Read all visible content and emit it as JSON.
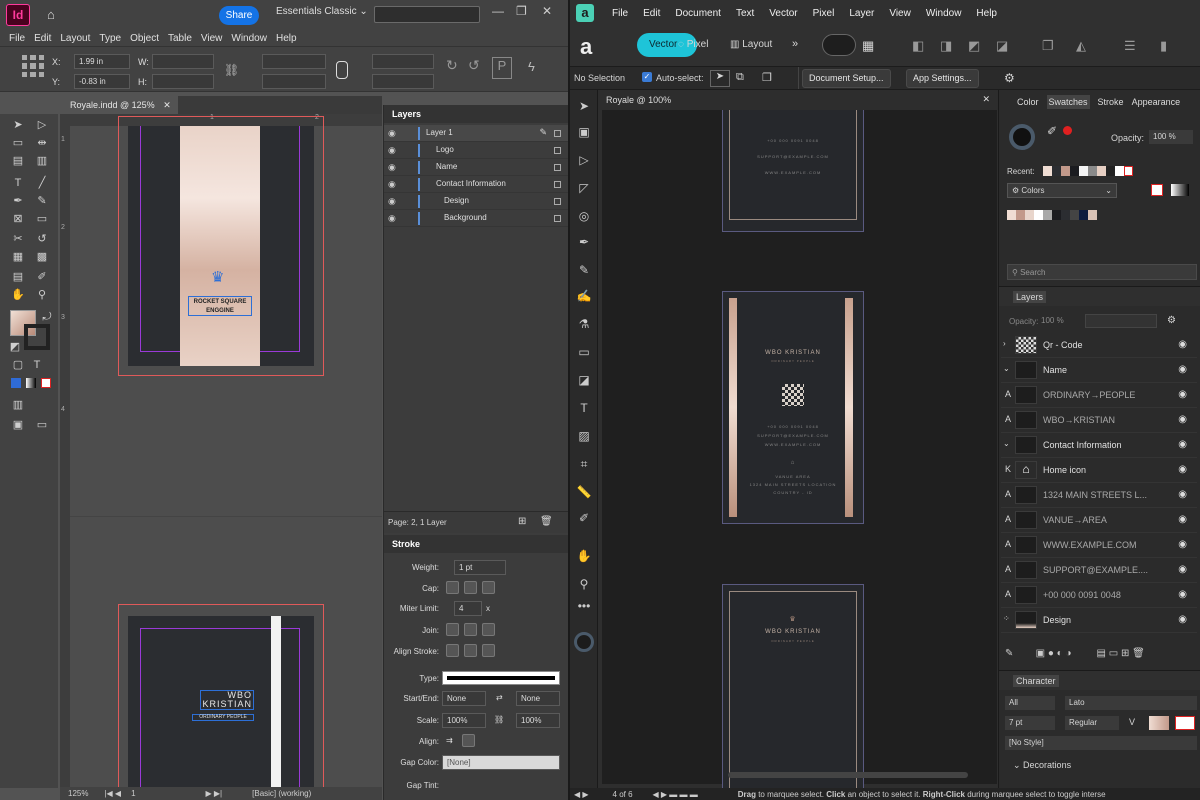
{
  "indesign": {
    "app_icon": "Id",
    "share_label": "Share",
    "workspace": "Essentials Classic",
    "menu": [
      "File",
      "Edit",
      "Layout",
      "Type",
      "Object",
      "Table",
      "View",
      "Window",
      "Help"
    ],
    "x_label": "X:",
    "x_value": "1.99 in",
    "y_label": "Y:",
    "y_value": "-0.83 in",
    "w_label": "W:",
    "h_label": "H:",
    "doc_tab": "Royale.indd @ 125%",
    "ruler_marks": [
      "1",
      "2",
      "3",
      "4"
    ],
    "top_ruler": [
      "1",
      "2"
    ],
    "page1_text_line1": "ROCKET SQUARE",
    "page1_text_line2": "ENGGINE",
    "page2_name_line1": "WBO",
    "page2_name_line2": "KRISTIAN",
    "page2_tagline": "ORDINARY PEOPLE",
    "zoom": "125%",
    "page_number": "1",
    "status": "[Basic] (working)",
    "layers": {
      "title": "Layers",
      "items": [
        "Layer 1",
        "Logo",
        "Name",
        "Contact Information",
        "Design",
        "Background"
      ],
      "footer": "Page: 2, 1 Layer"
    },
    "stroke": {
      "title": "Stroke",
      "weight_label": "Weight:",
      "weight": "1 pt",
      "cap_label": "Cap:",
      "miter_label": "Miter Limit:",
      "miter": "4",
      "miter_x": "x",
      "join_label": "Join:",
      "align_label": "Align Stroke:",
      "type_label": "Type:",
      "startend_label": "Start/End:",
      "start": "None",
      "end": "None",
      "scale_label": "Scale:",
      "scale1": "100%",
      "scale2": "100%",
      "align2_label": "Align:",
      "gapcolor_label": "Gap Color:",
      "gapcolor": "[None]",
      "gaptint_label": "Gap Tint:"
    }
  },
  "affinity": {
    "app_icon": "a",
    "menu": [
      "File",
      "Edit",
      "Document",
      "Text",
      "Vector",
      "Pixel",
      "Layer",
      "View",
      "Window",
      "Help"
    ],
    "persona_vector": "Vector",
    "persona_pixel": "Pixel",
    "persona_layout": "Layout",
    "selection": "No Selection",
    "autoselect": "Auto-select:",
    "doc_setup": "Document Setup...",
    "app_settings": "App Settings...",
    "doc_title": "Royale @ 100%",
    "card_top_lines": [
      "+00 000 0091 0048",
      "SUPPORT@EXAMPLE.COM",
      "WWW.EXAMPLE.COM"
    ],
    "card_mid_name": "WBO KRISTIAN",
    "card_mid_tag": "ORDINARY PEOPLE",
    "card_mid_contact": [
      "+00 000 0091 0048",
      "SUPPORT@EXAMPLE.COM",
      "WWW.EXAMPLE.COM"
    ],
    "card_mid_addr": [
      "VANUE AREA",
      "1324 MAIN STREETS LOCATION",
      "COUNTRY - ID"
    ],
    "card_bot_name": "WBO KRISTIAN",
    "card_bot_tag": "ORDINARY PEOPLE",
    "page_status": "4 of 6",
    "hint": {
      "b1": "Drag",
      "t1": " to marquee select. ",
      "b2": "Click",
      "t2": " an object to select it. ",
      "b3": "Right-Click",
      "t3": " during marquee select to toggle interse"
    },
    "right_tabs": [
      "Color",
      "Swatches",
      "Stroke",
      "Appearance"
    ],
    "opacity_label": "Opacity:",
    "opacity": "100 %",
    "recent_label": "Recent:",
    "colors_dropdown": "Colors",
    "search_placeholder": "Search",
    "layers_title": "Layers",
    "layers_opacity_label": "Opacity:",
    "layers_opacity": "100 %",
    "layers": [
      {
        "name": "Qr - Code"
      },
      {
        "name": "Name"
      },
      {
        "name": "ORDINARY→PEOPLE"
      },
      {
        "name": "WBO→KRISTIAN"
      },
      {
        "name": "Contact Information"
      },
      {
        "name": "Home icon"
      },
      {
        "name": "1324 MAIN STREETS L..."
      },
      {
        "name": "VANUE→AREA"
      },
      {
        "name": "WWW.EXAMPLE.COM"
      },
      {
        "name": "SUPPORT@EXAMPLE...."
      },
      {
        "name": "+00 000 0091 0048"
      },
      {
        "name": "Design"
      }
    ],
    "character_title": "Character",
    "char_all": "All",
    "font": "Lato",
    "font_size": "7 pt",
    "font_style": "Regular",
    "para_style": "[No Style]",
    "decorations": "Decorations"
  }
}
